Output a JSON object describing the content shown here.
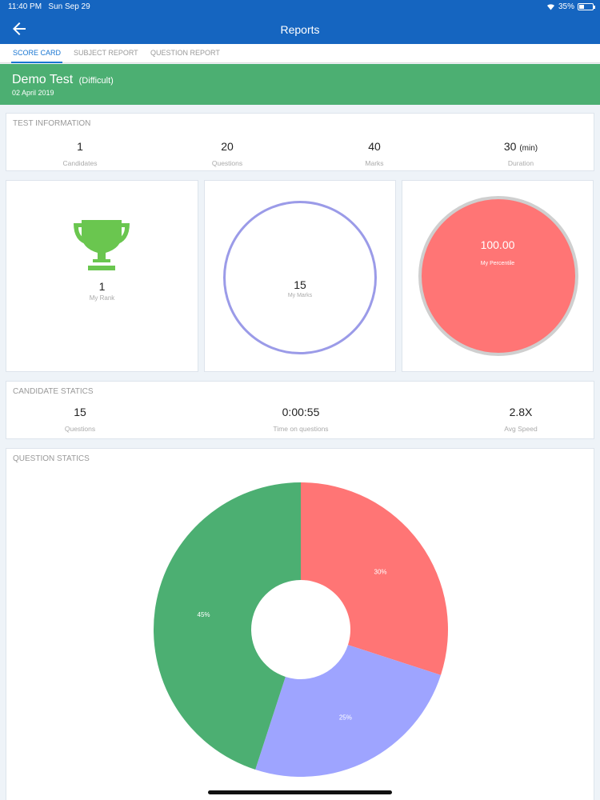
{
  "status": {
    "time": "11:40 PM",
    "date": "Sun Sep 29",
    "battery": "35%",
    "battery_level": 0.35
  },
  "nav": {
    "title": "Reports"
  },
  "tabs": [
    {
      "label": "SCORE CARD",
      "active": true
    },
    {
      "label": "SUBJECT REPORT",
      "active": false
    },
    {
      "label": "QUESTION REPORT",
      "active": false
    }
  ],
  "test": {
    "name": "Demo Test",
    "level": "(Difficult)",
    "date": "02 April 2019"
  },
  "test_info": {
    "title": "TEST INFORMATION",
    "stats": [
      {
        "value": "1",
        "label": "Candidates"
      },
      {
        "value": "20",
        "label": "Questions"
      },
      {
        "value": "40",
        "label": "Marks"
      },
      {
        "value": "30",
        "unit": "(min)",
        "label": "Duration"
      }
    ]
  },
  "rank": {
    "value": "1",
    "label": "My Rank"
  },
  "marks": {
    "value": "15",
    "label": "My Marks"
  },
  "percentile": {
    "value": "100.00",
    "label": "My Percentile"
  },
  "candidate_statics": {
    "title": "CANDIDATE STATICS",
    "stats": [
      {
        "value": "15",
        "label": "Questions"
      },
      {
        "value": "0:00:55",
        "label": "Time on questions"
      },
      {
        "value": "2.8X",
        "label": "Avg Speed"
      }
    ]
  },
  "question_statics": {
    "title": "QUESTION STATICS"
  },
  "colors": {
    "primary": "#1565c0",
    "green": "#4caf72",
    "red": "#ff7575",
    "purple": "#9ea4ff"
  },
  "chart_data": {
    "type": "pie",
    "donut": true,
    "categories": [
      "",
      "",
      ""
    ],
    "values": [
      30,
      25,
      45
    ],
    "labels": [
      "30%",
      "25%",
      "45%"
    ],
    "colors": [
      "#ff7575",
      "#9ea4ff",
      "#4caf72"
    ]
  }
}
